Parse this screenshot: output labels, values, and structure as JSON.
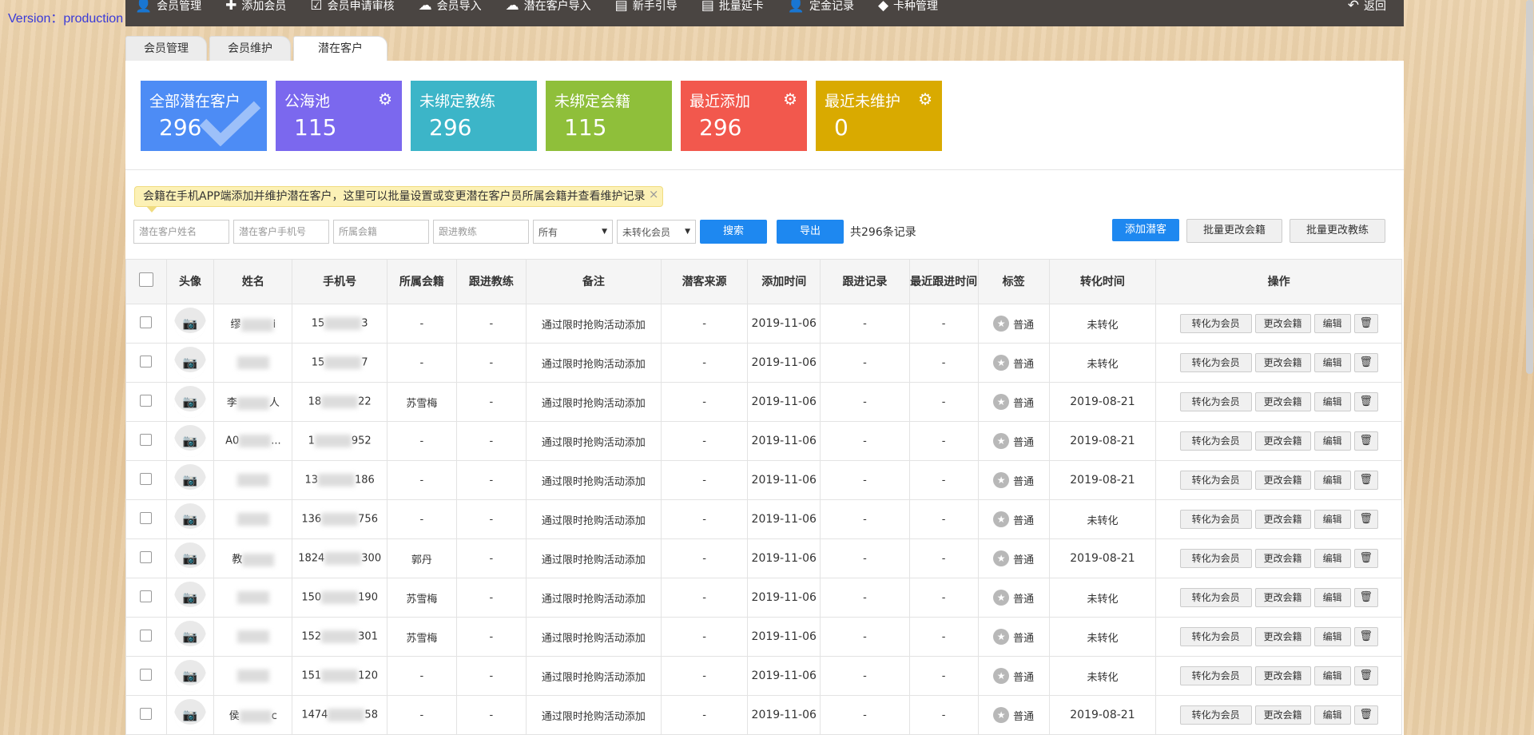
{
  "version": "Version：production",
  "topbar": {
    "items": [
      {
        "icon": "user-icon",
        "glyph": "👤",
        "label": "会员管理"
      },
      {
        "icon": "plus-icon",
        "glyph": "✚",
        "label": "添加会员"
      },
      {
        "icon": "check-icon",
        "glyph": "☑",
        "label": "会员申请审核"
      },
      {
        "icon": "cloud-upload-icon",
        "glyph": "☁",
        "label": "会员导入"
      },
      {
        "icon": "cloud-upload-icon",
        "glyph": "☁",
        "label": "潜在客户导入"
      },
      {
        "icon": "card-icon",
        "glyph": "▤",
        "label": "新手引导"
      },
      {
        "icon": "card-icon",
        "glyph": "▤",
        "label": "批量延卡"
      },
      {
        "icon": "user-icon",
        "glyph": "👤",
        "label": "定金记录"
      },
      {
        "icon": "tag-icon",
        "glyph": "◆",
        "label": "卡种管理"
      }
    ],
    "back": "返回"
  },
  "tabs": [
    {
      "label": "会员管理",
      "active": false
    },
    {
      "label": "会员维护",
      "active": false
    },
    {
      "label": "潜在客户",
      "active": true
    }
  ],
  "stats": [
    {
      "label": "全部潜在客户",
      "value": "296",
      "color": "#4d8cf5",
      "gear": false,
      "check": true
    },
    {
      "label": "公海池",
      "value": "115",
      "color": "#7b68ee",
      "gear": true,
      "check": false
    },
    {
      "label": "未绑定教练",
      "value": "296",
      "color": "#3cb5c8",
      "gear": false,
      "check": false
    },
    {
      "label": "未绑定会籍",
      "value": "115",
      "color": "#8fbf3a",
      "gear": false,
      "check": false
    },
    {
      "label": "最近添加",
      "value": "296",
      "color": "#f2584d",
      "gear": true,
      "check": false
    },
    {
      "label": "最近未维护",
      "value": "0",
      "color": "#d9aa00",
      "gear": true,
      "check": false
    }
  ],
  "notice": "会籍在手机APP端添加并维护潜在客户，这里可以批量设置或变更潜在客户员所属会籍并查看维护记录",
  "search": {
    "name_placeholder": "潜在客户姓名",
    "phone_placeholder": "潜在客户手机号",
    "membership_placeholder": "所属会籍",
    "coach_placeholder": "跟进教练",
    "select1": "所有",
    "select2": "未转化会员",
    "search_btn": "搜索",
    "export_btn": "导出",
    "record_count": "共296条记录"
  },
  "actions": {
    "add": "添加潜客",
    "batch_membership": "批量更改会籍",
    "batch_coach": "批量更改教练"
  },
  "table": {
    "headers": [
      "头像",
      "姓名",
      "手机号",
      "所属会籍",
      "跟进教练",
      "备注",
      "潜客来源",
      "添加时间",
      "跟进记录",
      "最近跟进时间",
      "标签",
      "转化时间",
      "操作"
    ],
    "op_labels": {
      "convert": "转化为会员",
      "change": "更改会籍",
      "edit": "编辑"
    },
    "rows": [
      {
        "name_pre": "缪",
        "name_suf": "i",
        "phone_pre": "15",
        "phone_suf": "3",
        "membership": "-",
        "coach": "-",
        "note": "通过限时抢购活动添加",
        "source": "-",
        "added": "2019-11-06",
        "follow": "-",
        "last_follow": "-",
        "tag": "普通",
        "converted": "未转化"
      },
      {
        "name_pre": "",
        "name_suf": "",
        "phone_pre": "15",
        "phone_suf": "7",
        "membership": "-",
        "coach": "-",
        "note": "通过限时抢购活动添加",
        "source": "-",
        "added": "2019-11-06",
        "follow": "-",
        "last_follow": "-",
        "tag": "普通",
        "converted": "未转化"
      },
      {
        "name_pre": "李",
        "name_suf": "人",
        "phone_pre": "18",
        "phone_suf": "22",
        "membership": "苏雪梅",
        "coach": "-",
        "note": "通过限时抢购活动添加",
        "source": "-",
        "added": "2019-11-06",
        "follow": "-",
        "last_follow": "-",
        "tag": "普通",
        "converted": "2019-08-21"
      },
      {
        "name_pre": "A0",
        "name_suf": "...",
        "phone_pre": "1",
        "phone_suf": "952",
        "membership": "-",
        "coach": "-",
        "note": "通过限时抢购活动添加",
        "source": "-",
        "added": "2019-11-06",
        "follow": "-",
        "last_follow": "-",
        "tag": "普通",
        "converted": "2019-08-21"
      },
      {
        "name_pre": "",
        "name_suf": "",
        "phone_pre": "13",
        "phone_suf": "186",
        "membership": "-",
        "coach": "-",
        "note": "通过限时抢购活动添加",
        "source": "-",
        "added": "2019-11-06",
        "follow": "-",
        "last_follow": "-",
        "tag": "普通",
        "converted": "2019-08-21"
      },
      {
        "name_pre": "",
        "name_suf": "",
        "phone_pre": "136",
        "phone_suf": "756",
        "membership": "-",
        "coach": "-",
        "note": "通过限时抢购活动添加",
        "source": "-",
        "added": "2019-11-06",
        "follow": "-",
        "last_follow": "-",
        "tag": "普通",
        "converted": "未转化"
      },
      {
        "name_pre": "教",
        "name_suf": "",
        "phone_pre": "1824",
        "phone_suf": "300",
        "membership": "郭丹",
        "coach": "-",
        "note": "通过限时抢购活动添加",
        "source": "-",
        "added": "2019-11-06",
        "follow": "-",
        "last_follow": "-",
        "tag": "普通",
        "converted": "2019-08-21"
      },
      {
        "name_pre": "",
        "name_suf": "",
        "phone_pre": "150",
        "phone_suf": "190",
        "membership": "苏雪梅",
        "coach": "-",
        "note": "通过限时抢购活动添加",
        "source": "-",
        "added": "2019-11-06",
        "follow": "-",
        "last_follow": "-",
        "tag": "普通",
        "converted": "未转化"
      },
      {
        "name_pre": "",
        "name_suf": "",
        "phone_pre": "152",
        "phone_suf": "301",
        "membership": "苏雪梅",
        "coach": "-",
        "note": "通过限时抢购活动添加",
        "source": "-",
        "added": "2019-11-06",
        "follow": "-",
        "last_follow": "-",
        "tag": "普通",
        "converted": "未转化"
      },
      {
        "name_pre": "",
        "name_suf": "",
        "phone_pre": "151",
        "phone_suf": "120",
        "membership": "-",
        "coach": "-",
        "note": "通过限时抢购活动添加",
        "source": "-",
        "added": "2019-11-06",
        "follow": "-",
        "last_follow": "-",
        "tag": "普通",
        "converted": "未转化"
      },
      {
        "name_pre": "侯",
        "name_suf": "c",
        "phone_pre": "1474",
        "phone_suf": "58",
        "membership": "-",
        "coach": "-",
        "note": "通过限时抢购活动添加",
        "source": "-",
        "added": "2019-11-06",
        "follow": "-",
        "last_follow": "-",
        "tag": "普通",
        "converted": "2019-08-21"
      }
    ]
  }
}
